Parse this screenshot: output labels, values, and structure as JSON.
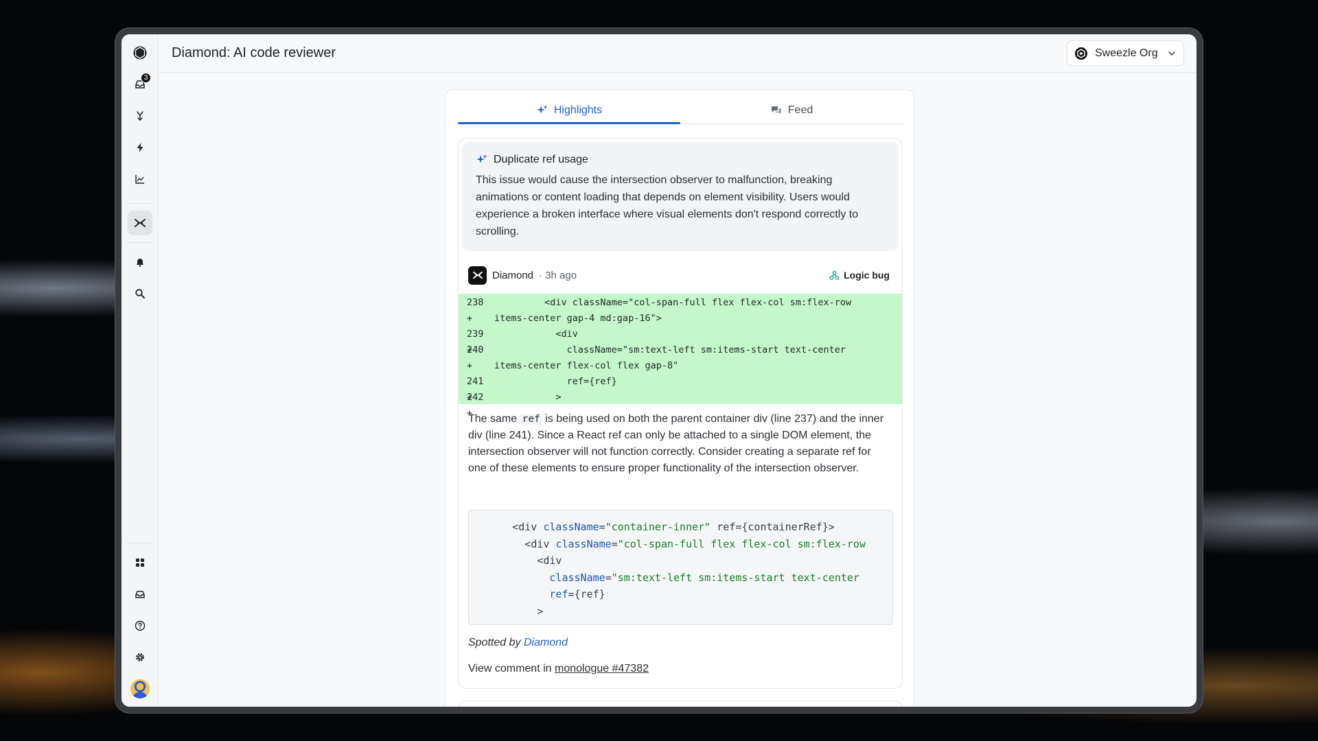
{
  "header": {
    "title": "Diamond: AI code reviewer",
    "org_name": "Sweezle Org"
  },
  "sidebar": {
    "inbox_badge": "3",
    "items": [
      {
        "icon": "logo-icon"
      },
      {
        "icon": "inbox-icon"
      },
      {
        "icon": "merge-icon"
      },
      {
        "icon": "bolt-icon"
      },
      {
        "icon": "chart-icon"
      },
      {
        "icon": "diamond-icon",
        "active": true
      },
      {
        "icon": "bell-icon"
      },
      {
        "icon": "search-icon"
      },
      {
        "icon": "grid-icon"
      },
      {
        "icon": "tray-icon"
      },
      {
        "icon": "help-icon"
      },
      {
        "icon": "gear-icon"
      },
      {
        "icon": "avatar"
      }
    ]
  },
  "tabs": [
    {
      "label": "Highlights",
      "active": true
    },
    {
      "label": "Feed",
      "active": false
    }
  ],
  "issue": {
    "title": "Duplicate ref usage",
    "summary": "This issue would cause the intersection observer to malfunction, breaking animations or content loading that depends on element visibility. Users would experience a broken interface where visual elements don't respond correctly to scrolling.",
    "author": "Diamond",
    "time": " · 3h ago",
    "tag": "Logic bug",
    "diff": [
      {
        "ln": "238 +",
        "code": "         <div className=\"col-span-full flex flex-col sm:flex-row"
      },
      {
        "ln": "",
        "code": "items-center gap-4 md:gap-16\">"
      },
      {
        "ln": "239 +",
        "code": "           <div"
      },
      {
        "ln": "240 +",
        "code": "             className=\"sm:text-left sm:items-start text-center"
      },
      {
        "ln": "",
        "code": "items-center flex-col flex gap-8\""
      },
      {
        "ln": "241 +",
        "code": "             ref={ref}"
      },
      {
        "ln": "242 +",
        "code": "           >"
      }
    ],
    "description_before": "The same ",
    "description_code": "ref",
    "description_after": " is being used on both the parent container div (line 237) and the inner div (line 241). Since a React ref can only be attached to a single DOM element, the intersection observer will not function correctly. Consider creating a separate ref for one of these elements to ensure proper functionality of the intersection observer.",
    "snippet": [
      {
        "indent": "       ",
        "tag": "<div ",
        "attr": "className",
        "eq": "=",
        "str": "\"container-inner\"",
        "rest": " ref={containerRef}>"
      },
      {
        "indent": "         ",
        "tag": "<div ",
        "attr": "className",
        "eq": "=",
        "str": "\"col-span-full flex flex-col sm:flex-row",
        "rest": ""
      },
      {
        "indent": "           ",
        "tag": "<div",
        "attr": "",
        "eq": "",
        "str": "",
        "rest": ""
      },
      {
        "indent": "             ",
        "tag": "",
        "attr": "className",
        "eq": "=",
        "str": "\"sm:text-left sm:items-start text-center",
        "rest": ""
      },
      {
        "indent": "             ",
        "tag": "",
        "attr": "ref",
        "eq": "=",
        "str": "",
        "rest": "{ref}"
      },
      {
        "indent": "           ",
        "tag": ">",
        "attr": "",
        "eq": "",
        "str": "",
        "rest": ""
      }
    ],
    "spotted_prefix": "Spotted by ",
    "spotted_by": "Diamond",
    "view_prefix": "View comment in ",
    "view_link": "monologue #47382"
  },
  "colors": {
    "accent": "#1d5fd1",
    "diff_added": "#c5f7cb",
    "tag_icon": "#14a38b"
  }
}
